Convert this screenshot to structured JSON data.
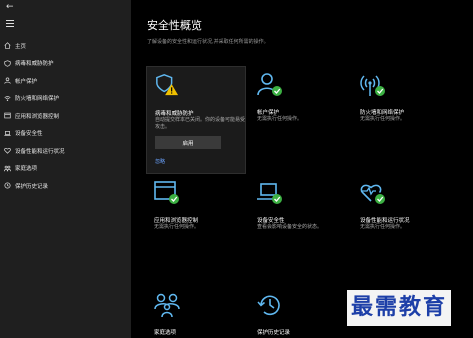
{
  "sidebar": {
    "back_glyph": "←",
    "items": [
      {
        "label": "主页",
        "icon": "home-icon"
      },
      {
        "label": "病毒和威胁防护",
        "icon": "shield-icon"
      },
      {
        "label": "帐户保护",
        "icon": "person-icon"
      },
      {
        "label": "防火墙和网络保护",
        "icon": "wifi-icon"
      },
      {
        "label": "应用和浏览器控制",
        "icon": "app-window-icon"
      },
      {
        "label": "设备安全性",
        "icon": "laptop-icon"
      },
      {
        "label": "设备性能和运行状况",
        "icon": "heart-icon"
      },
      {
        "label": "家庭选项",
        "icon": "family-icon"
      },
      {
        "label": "保护历史记录",
        "icon": "history-icon"
      }
    ]
  },
  "main": {
    "title": "安全性概览",
    "subtitle": "了解设备的安全性和运行状况,并采取任何所需的操作。",
    "cards": [
      {
        "title": "病毒和威胁防护",
        "desc": "自动提交样本已关闭。你的设备可能易受攻击。",
        "button": "启用",
        "link": "忽略",
        "status": "warning"
      },
      {
        "title": "帐户保护",
        "desc": "无需执行任何操作。",
        "status": "ok"
      },
      {
        "title": "防火墙和网络保护",
        "desc": "无需执行任何操作。",
        "status": "ok"
      },
      {
        "title": "应用和浏览器控制",
        "desc": "无需执行任何操作。",
        "status": "ok"
      },
      {
        "title": "设备安全性",
        "desc": "查看会影响设备安全的状态。",
        "status": "ok"
      },
      {
        "title": "设备性能和运行状况",
        "desc": "无需执行任何操作。",
        "status": "ok"
      },
      {
        "title": "家庭选项",
        "desc": ""
      },
      {
        "title": "保护历史记录",
        "desc": ""
      }
    ]
  },
  "watermark": "最需教育",
  "colors": {
    "accent": "#60b8f0",
    "ok": "#3cb043",
    "warning": "#f0c000",
    "link": "#6aa3ff"
  }
}
